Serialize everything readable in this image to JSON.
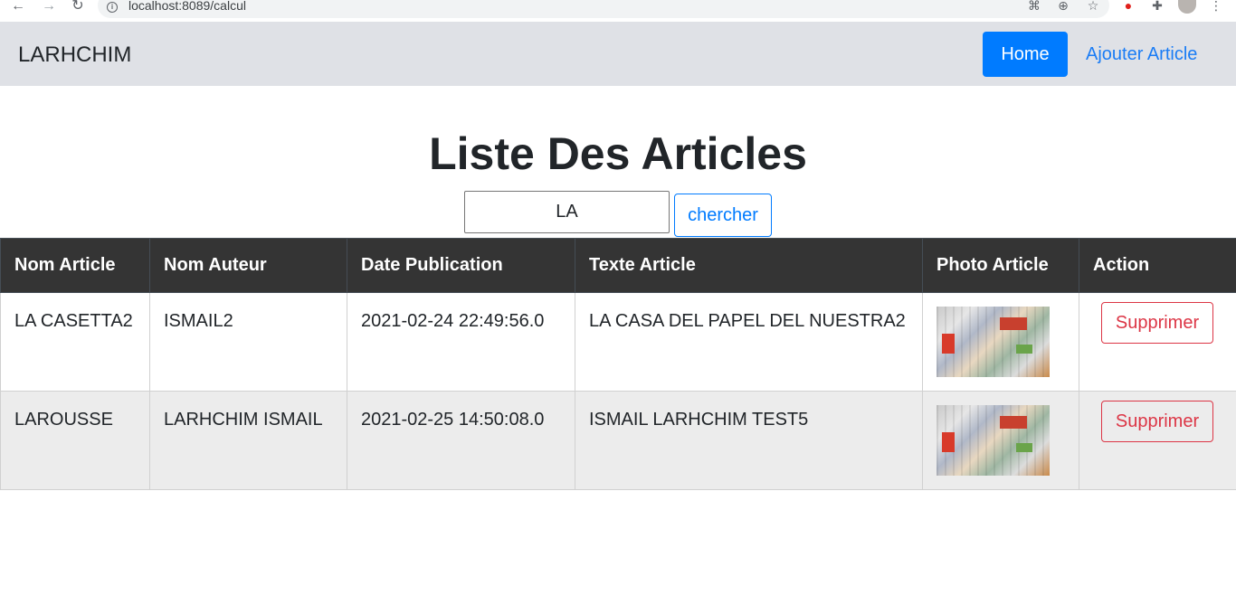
{
  "browser": {
    "url": "localhost:8089/calcul"
  },
  "navbar": {
    "brand": "LARHCHIM",
    "home_label": "Home",
    "add_label": "Ajouter Article"
  },
  "page": {
    "title": "Liste Des Articles"
  },
  "search": {
    "value": "LA",
    "button_label": "chercher"
  },
  "table": {
    "headers": [
      "Nom Article",
      "Nom Auteur",
      "Date Publication",
      "Texte Article",
      "Photo Article",
      "Action"
    ],
    "rows": [
      {
        "nom_article": "LA CASETTA2",
        "nom_auteur": "ISMAIL2",
        "date": "2021-02-24 22:49:56.0",
        "texte": "LA CASA DEL PAPEL DEL NUESTRA2",
        "action": "Supprimer"
      },
      {
        "nom_article": "LAROUSSE",
        "nom_auteur": "LARHCHIM ISMAIL",
        "date": "2021-02-25 14:50:08.0",
        "texte": "ISMAIL LARHCHIM TEST5",
        "action": "Supprimer"
      }
    ]
  },
  "colors": {
    "primary": "#007bff",
    "danger": "#dc3545",
    "header_dark": "#343434",
    "navbar_bg": "#dfe1e6"
  },
  "icons": [
    "back-arrow-icon",
    "forward-arrow-icon",
    "reload-icon",
    "info-icon",
    "translate-icon",
    "zoom-icon",
    "star-icon",
    "extension-red-icon",
    "puzzle-icon",
    "profile-avatar",
    "menu-dots-icon"
  ]
}
